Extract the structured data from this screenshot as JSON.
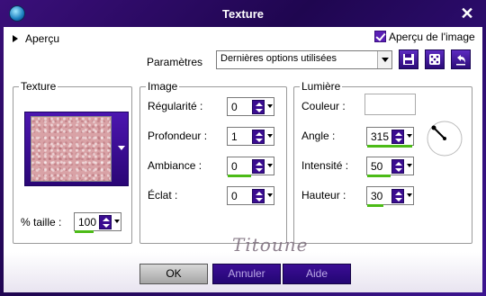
{
  "window": {
    "title": "Texture",
    "close": "✕"
  },
  "apercu": {
    "label": "Aperçu"
  },
  "preview": {
    "label": "Aperçu de l'image",
    "checked": true
  },
  "parametres": {
    "label": "Paramètres",
    "value": "Dernières options utilisées"
  },
  "texture": {
    "title": "Texture",
    "size_label": "% taille :",
    "size_value": "100",
    "size_fill_pct": 40
  },
  "image": {
    "title": "Image",
    "regularite_label": "Régularité :",
    "regularite_value": "0",
    "profondeur_label": "Profondeur :",
    "profondeur_value": "1",
    "ambiance_label": "Ambiance :",
    "ambiance_value": "0",
    "eclat_label": "Éclat :",
    "eclat_value": "0"
  },
  "lumiere": {
    "title": "Lumière",
    "couleur_label": "Couleur :",
    "couleur_value": "#ffffff",
    "angle_label": "Angle :",
    "angle_value": "315",
    "intensite_label": "Intensité :",
    "intensite_value": "50",
    "hauteur_label": "Hauteur :",
    "hauteur_value": "30"
  },
  "buttons": {
    "ok": "OK",
    "cancel": "Annuler",
    "help": "Aide"
  },
  "signature": "Titoune",
  "colors": {
    "accent": "#3a0c90",
    "fill_bar": "#4cbb17",
    "texture": "#d9a2a6"
  }
}
